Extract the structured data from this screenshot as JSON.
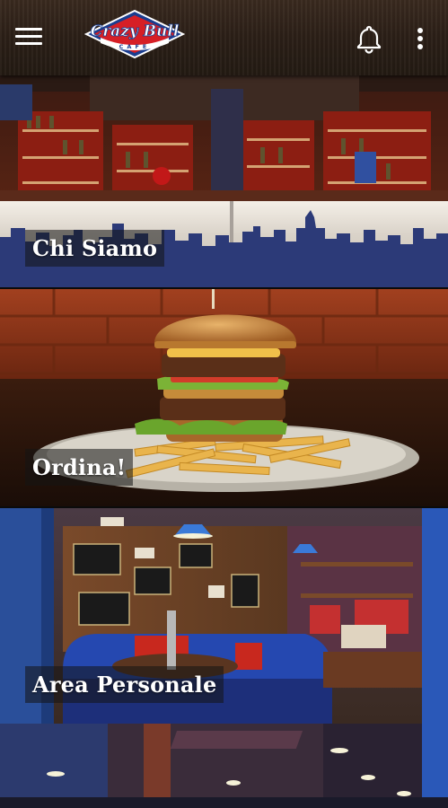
{
  "app": {
    "logo_text_top": "Crazy Bull",
    "logo_text_bottom": "CAFE"
  },
  "toolbar": {
    "menu_icon": "hamburger-menu-icon",
    "notifications_icon": "bell-icon",
    "more_icon": "more-vertical-icon"
  },
  "tiles": [
    {
      "label": "Chi Siamo"
    },
    {
      "label": "Ordina!"
    },
    {
      "label": "Area Personale"
    },
    {
      "label": ""
    }
  ],
  "colors": {
    "topbar": "#2b1f17",
    "label_bg": "rgba(20,20,20,.55)",
    "logo_red": "#d61f26",
    "logo_blue": "#1a3d8f"
  }
}
